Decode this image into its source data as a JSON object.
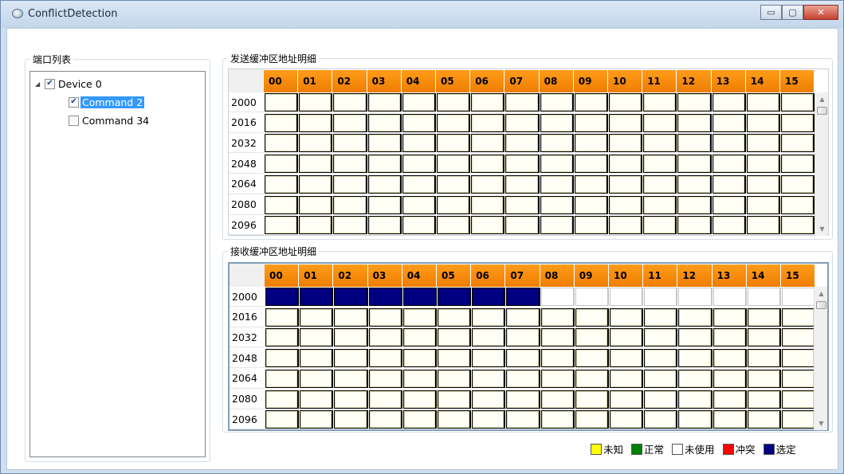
{
  "window": {
    "title": "ConflictDetection",
    "minimize_glyph": "▭",
    "maximize_glyph": "▢",
    "close_glyph": "✕"
  },
  "port_list": {
    "title": "端口列表",
    "items": [
      {
        "label": "Device 0",
        "checked": true,
        "level": 0,
        "expanded": true
      },
      {
        "label": "Command 2",
        "checked": true,
        "level": 1,
        "selected": true
      },
      {
        "label": "Command 34",
        "checked": false,
        "level": 1
      }
    ]
  },
  "send_buffer": {
    "title": "发送缓冲区地址明细",
    "columns": [
      "00",
      "01",
      "02",
      "03",
      "04",
      "05",
      "06",
      "07",
      "08",
      "09",
      "10",
      "11",
      "12",
      "13",
      "14",
      "15"
    ],
    "rows": [
      "2000",
      "2016",
      "2032",
      "2048",
      "2064",
      "2080",
      "2096"
    ],
    "states": [
      [
        "unknown",
        "unknown",
        "unknown",
        "unknown",
        "unknown",
        "unknown",
        "unknown",
        "unknown",
        "unknown",
        "unknown",
        "unknown",
        "unknown",
        "unknown",
        "unknown",
        "unknown",
        "unknown"
      ],
      [
        "unknown",
        "unknown",
        "unknown",
        "unknown",
        "unknown",
        "unknown",
        "unknown",
        "unknown",
        "unknown",
        "unknown",
        "unknown",
        "unknown",
        "unknown",
        "unknown",
        "unknown",
        "unknown"
      ],
      [
        "unknown",
        "unknown",
        "unknown",
        "unknown",
        "unknown",
        "unknown",
        "unknown",
        "unknown",
        "unknown",
        "unknown",
        "unknown",
        "unknown",
        "unknown",
        "unknown",
        "unknown",
        "unknown"
      ],
      [
        "unknown",
        "unknown",
        "unknown",
        "unknown",
        "unknown",
        "unknown",
        "unknown",
        "unknown",
        "unknown",
        "unknown",
        "unknown",
        "unknown",
        "unknown",
        "unknown",
        "unknown",
        "unknown"
      ],
      [
        "unknown",
        "unknown",
        "unknown",
        "unknown",
        "unknown",
        "unknown",
        "unknown",
        "unknown",
        "unknown",
        "unknown",
        "unknown",
        "unknown",
        "unknown",
        "unknown",
        "unknown",
        "unknown"
      ],
      [
        "unknown",
        "unknown",
        "unknown",
        "unknown",
        "unknown",
        "unknown",
        "unknown",
        "unknown",
        "unknown",
        "unknown",
        "unknown",
        "unknown",
        "unknown",
        "unknown",
        "unknown",
        "unknown"
      ],
      [
        "unknown",
        "unknown",
        "unknown",
        "unknown",
        "unknown",
        "unknown",
        "unknown",
        "unknown",
        "unknown",
        "unknown",
        "unknown",
        "unknown",
        "unknown",
        "unknown",
        "unknown",
        "unknown"
      ]
    ]
  },
  "recv_buffer": {
    "title": "接收缓冲区地址明细",
    "columns": [
      "00",
      "01",
      "02",
      "03",
      "04",
      "05",
      "06",
      "07",
      "08",
      "09",
      "10",
      "11",
      "12",
      "13",
      "14",
      "15"
    ],
    "rows": [
      "2000",
      "2016",
      "2032",
      "2048",
      "2064",
      "2080",
      "2096"
    ],
    "states": [
      [
        "selected",
        "selected",
        "selected",
        "selected",
        "selected",
        "selected",
        "selected",
        "selected",
        "unused",
        "unused",
        "unused",
        "unused",
        "unused",
        "unused",
        "unused",
        "unused"
      ],
      [
        "unknown",
        "unknown",
        "unknown",
        "unknown",
        "unknown",
        "unknown",
        "unknown",
        "unknown",
        "unknown",
        "unknown",
        "unknown",
        "unknown",
        "unknown",
        "unknown",
        "unknown",
        "unknown"
      ],
      [
        "unknown",
        "unknown",
        "unknown",
        "unknown",
        "unknown",
        "unknown",
        "unknown",
        "unknown",
        "unknown",
        "unknown",
        "unknown",
        "unknown",
        "unknown",
        "unknown",
        "unknown",
        "unknown"
      ],
      [
        "unknown",
        "unknown",
        "unknown",
        "unknown",
        "unknown",
        "unknown",
        "unknown",
        "unknown",
        "unknown",
        "unknown",
        "unknown",
        "unknown",
        "unknown",
        "unknown",
        "unknown",
        "unknown"
      ],
      [
        "unknown",
        "unknown",
        "unknown",
        "unknown",
        "unknown",
        "unknown",
        "unknown",
        "unknown",
        "unknown",
        "unknown",
        "unknown",
        "unknown",
        "unknown",
        "unknown",
        "unknown",
        "unknown"
      ],
      [
        "unknown",
        "unknown",
        "unknown",
        "unknown",
        "unknown",
        "unknown",
        "unknown",
        "unknown",
        "unknown",
        "unknown",
        "unknown",
        "unknown",
        "unknown",
        "unknown",
        "unknown",
        "unknown"
      ],
      [
        "unknown",
        "unknown",
        "unknown",
        "unknown",
        "unknown",
        "unknown",
        "unknown",
        "unknown",
        "unknown",
        "unknown",
        "unknown",
        "unknown",
        "unknown",
        "unknown",
        "unknown",
        "unknown"
      ]
    ]
  },
  "legend": [
    {
      "label": "未知",
      "color": "#ffff00"
    },
    {
      "label": "正常",
      "color": "#008000"
    },
    {
      "label": "未使用",
      "color": "#ffffff"
    },
    {
      "label": "冲突",
      "color": "#ff0000"
    },
    {
      "label": "选定",
      "color": "#000080"
    }
  ],
  "colors": {
    "header_orange": "#f08a00",
    "selected_navy": "#000080",
    "tree_selection": "#3399ff"
  }
}
